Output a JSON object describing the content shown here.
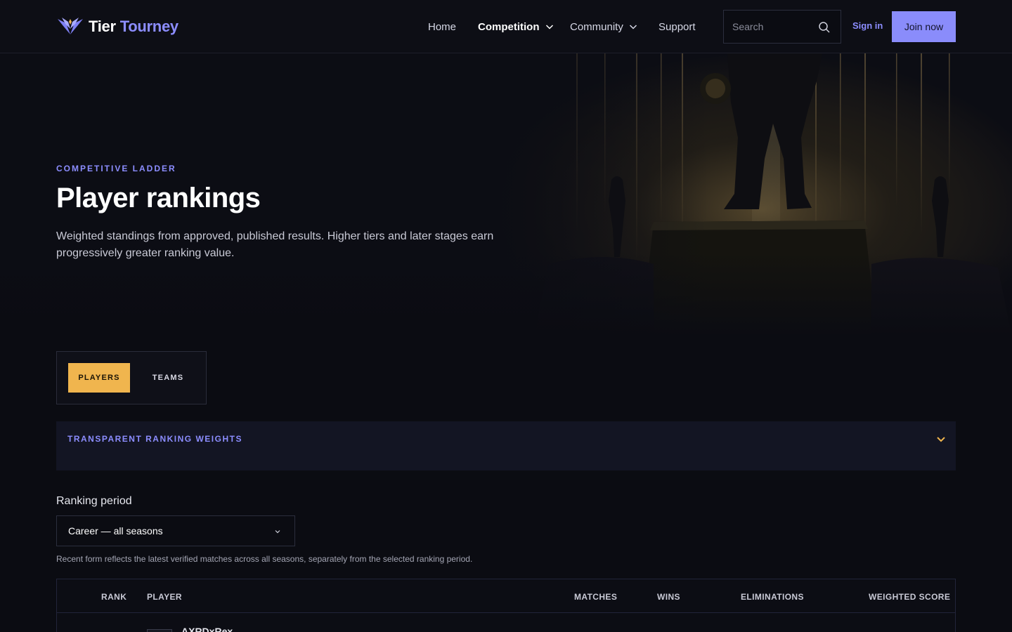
{
  "brand": {
    "name_part1": "Tier",
    "name_part2": "Tourney"
  },
  "nav": {
    "items": [
      {
        "label": "Home"
      },
      {
        "label": "Competition"
      },
      {
        "label": "Community"
      },
      {
        "label": "Support"
      }
    ],
    "active": "Competition"
  },
  "search": {
    "placeholder": "Search"
  },
  "auth": {
    "signin_label": "Sign in",
    "join_label": "Join now"
  },
  "hero": {
    "eyebrow": "COMPETITIVE LADDER",
    "title": "Player rankings",
    "subtitle": "Weighted standings from approved, published results. Higher tiers and later stages earn progressively greater ranking value."
  },
  "tabs": [
    {
      "label": "PLAYERS",
      "selected": true
    },
    {
      "label": "TEAMS",
      "selected": false
    }
  ],
  "weights_panel": {
    "label": "TRANSPARENT RANKING WEIGHTS"
  },
  "period": {
    "label": "Ranking period",
    "selected": "Career — all seasons",
    "note": "Recent form reflects the latest verified matches across all seasons, separately from the selected ranking period."
  },
  "table": {
    "columns": [
      "RANK",
      "PLAYER",
      "MATCHES",
      "WINS",
      "ELIMINATIONS",
      "WEIGHTED SCORE"
    ],
    "rows": [
      {
        "player": "AXRDxRex"
      }
    ]
  },
  "colors": {
    "accent": "#8c8dff",
    "tab_selected": "#f0b54e",
    "join_button": "#8a8cfb",
    "background": "#0b0c12"
  }
}
